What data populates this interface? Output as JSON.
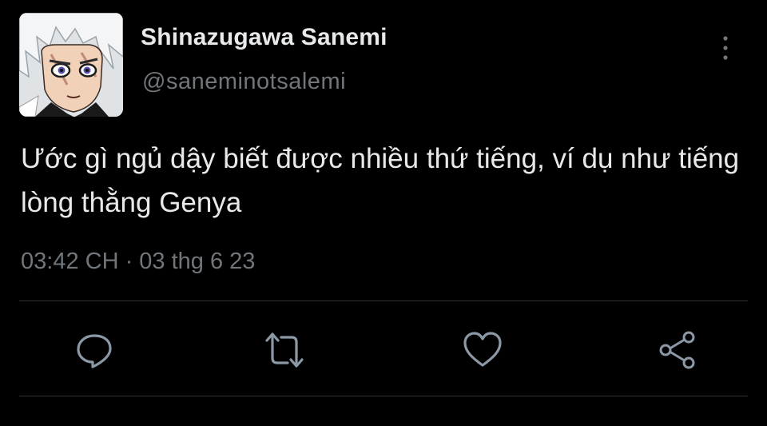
{
  "tweet": {
    "display_name": "Shinazugawa Sanemi",
    "handle": "@saneminotsalemi",
    "text": "Ước gì ngủ dậy biết được nhiều thứ tiếng, ví dụ như tiếng lòng thằng Genya",
    "timestamp": "03:42 CH · 03 thg 6 23"
  },
  "icons": {
    "more": "more-vertical-icon",
    "reply": "reply-icon",
    "retweet": "retweet-icon",
    "like": "heart-icon",
    "share": "share-icon"
  },
  "colors": {
    "background": "#000000",
    "primary_text": "#e7e9ea",
    "secondary_text": "#71767b",
    "divider": "#2f3336"
  }
}
